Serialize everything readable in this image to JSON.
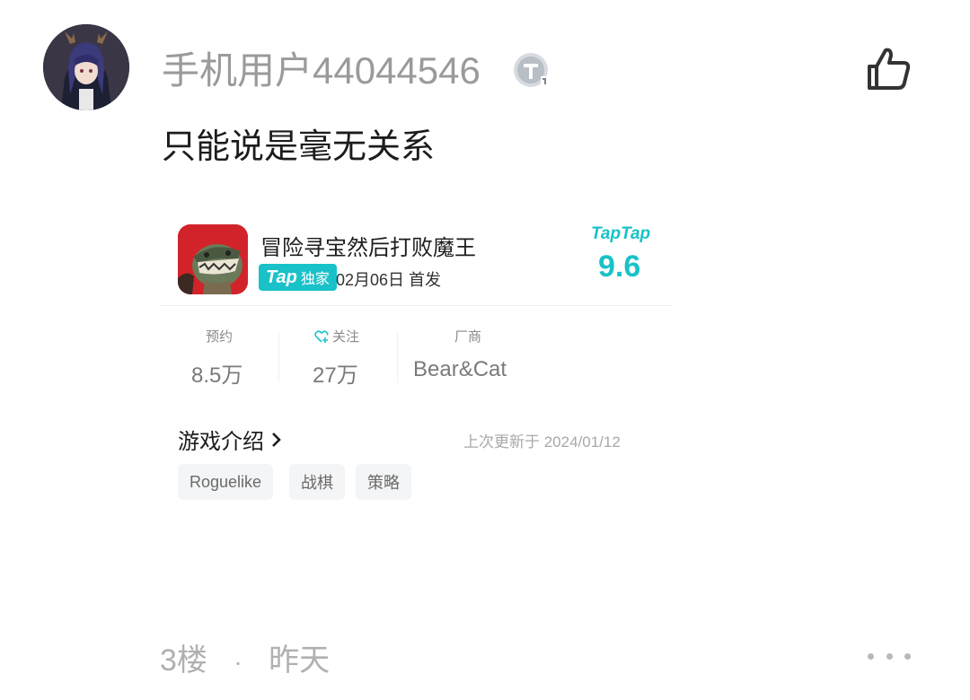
{
  "comment": {
    "username": "手机用户44044546",
    "badge_icon": "t-level-badge-icon",
    "text": "只能说是毫无关系",
    "like_icon": "thumbs-up-icon"
  },
  "game_card": {
    "title": "冒险寻宝然后打败魔王",
    "exclusive_badge": {
      "tap": "Tap",
      "label": "独家"
    },
    "release_info": "02月06日 首发",
    "logo_text": "TapTap",
    "score": "9.6",
    "stats": [
      {
        "label": "预约",
        "value": "8.5万"
      },
      {
        "label": "关注",
        "value": "27万",
        "icon": "heart-plus-icon"
      },
      {
        "label": "厂商",
        "value": "Bear&Cat"
      }
    ],
    "intro_label": "游戏介绍",
    "update_info": "上次更新于 2024/01/12",
    "tags": [
      "Roguelike",
      "战棋",
      "策略"
    ],
    "accent_color": "#18c2c8"
  },
  "footer": {
    "floor": "3楼",
    "separator": "·",
    "time": "昨天",
    "more_icon": "more-dots-icon"
  }
}
